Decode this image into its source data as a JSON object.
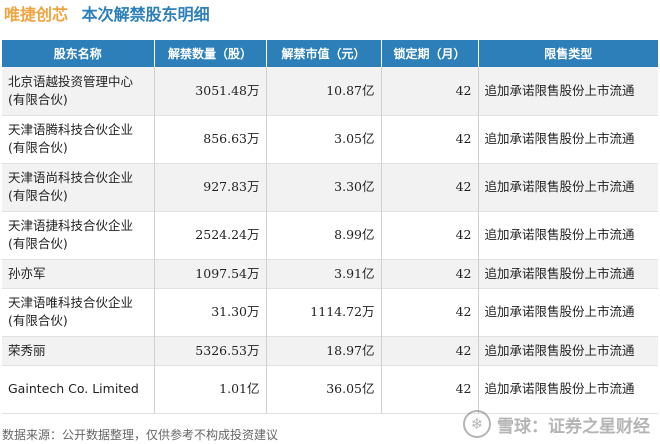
{
  "header": {
    "brand": "唯捷创芯",
    "title": "本次解禁股东明细"
  },
  "table": {
    "columns": [
      "股东名称",
      "解禁数量（股）",
      "解禁市值（元）",
      "锁定期（月）",
      "限售类型"
    ],
    "rows": [
      {
        "name": "北京语越投资管理中心(有限合伙)",
        "qty": "3051.48万",
        "value": "10.87亿",
        "lock": "42",
        "type": "追加承诺限售股份上市流通"
      },
      {
        "name": "天津语腾科技合伙企业(有限合伙)",
        "qty": "856.63万",
        "value": "3.05亿",
        "lock": "42",
        "type": "追加承诺限售股份上市流通"
      },
      {
        "name": "天津语尚科技合伙企业(有限合伙)",
        "qty": "927.83万",
        "value": "3.30亿",
        "lock": "42",
        "type": "追加承诺限售股份上市流通"
      },
      {
        "name": "天津语捷科技合伙企业(有限合伙)",
        "qty": "2524.24万",
        "value": "8.99亿",
        "lock": "42",
        "type": "追加承诺限售股份上市流通"
      },
      {
        "name": "孙亦军",
        "qty": "1097.54万",
        "value": "3.91亿",
        "lock": "42",
        "type": "追加承诺限售股份上市流通"
      },
      {
        "name": "天津语唯科技合伙企业(有限合伙)",
        "qty": "31.30万",
        "value": "1114.72万",
        "lock": "42",
        "type": "追加承诺限售股份上市流通"
      },
      {
        "name": "荣秀丽",
        "qty": "5326.53万",
        "value": "18.97亿",
        "lock": "42",
        "type": "追加承诺限售股份上市流通"
      },
      {
        "name": "Gaintech Co. Limited",
        "qty": "1.01亿",
        "value": "36.05亿",
        "lock": "42",
        "type": "追加承诺限售股份上市流通"
      }
    ]
  },
  "footer": {
    "source": "数据来源：公开数据整理，仅供参考不构成投资建议"
  },
  "watermark": {
    "text": "证券之星"
  },
  "badge": {
    "icon": "snowball-icon",
    "text": "雪球：证券之星财经"
  }
}
